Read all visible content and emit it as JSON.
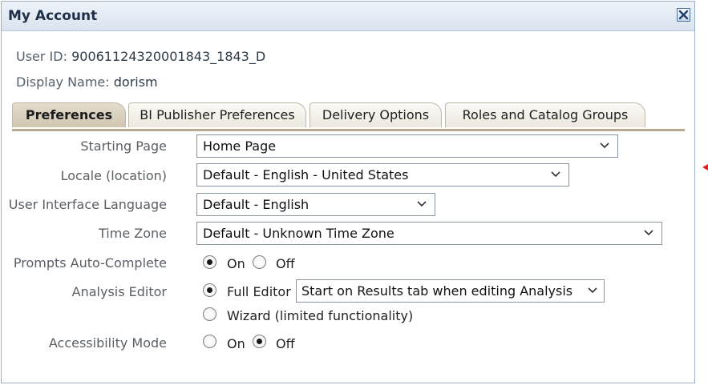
{
  "dialog": {
    "title": "My Account",
    "close_icon": "close-x-icon"
  },
  "user": {
    "id_label": "User ID:",
    "id_value": "90061124320001843_1843_D",
    "name_label": "Display Name:",
    "name_value": "dorism"
  },
  "tabs": [
    {
      "label": "Preferences",
      "active": true
    },
    {
      "label": "BI Publisher Preferences",
      "active": false
    },
    {
      "label": "Delivery Options",
      "active": false
    },
    {
      "label": "Roles and Catalog Groups",
      "active": false
    }
  ],
  "fields": {
    "starting_page": {
      "label": "Starting Page",
      "value": "Home Page"
    },
    "locale": {
      "label": "Locale (location)",
      "value": "Default - English - United States"
    },
    "ui_language": {
      "label": "User Interface Language",
      "value": "Default - English"
    },
    "time_zone": {
      "label": "Time Zone",
      "value": "Default - Unknown Time Zone"
    },
    "prompts_auto_complete": {
      "label": "Prompts Auto-Complete",
      "on": "On",
      "off": "Off",
      "selected": "On"
    },
    "analysis_editor": {
      "label": "Analysis Editor",
      "full": "Full Editor",
      "full_option": "Start on Results tab when editing Analysis",
      "wizard": "Wizard (limited functionality)",
      "selected": "Full Editor"
    },
    "accessibility_mode": {
      "label": "Accessibility Mode",
      "on": "On",
      "off": "Off",
      "selected": "Off"
    }
  },
  "colors": {
    "accent_marker": "#e01b1b",
    "tab_active": "#cfc5b0",
    "title_bar": "#d9e3ef"
  }
}
